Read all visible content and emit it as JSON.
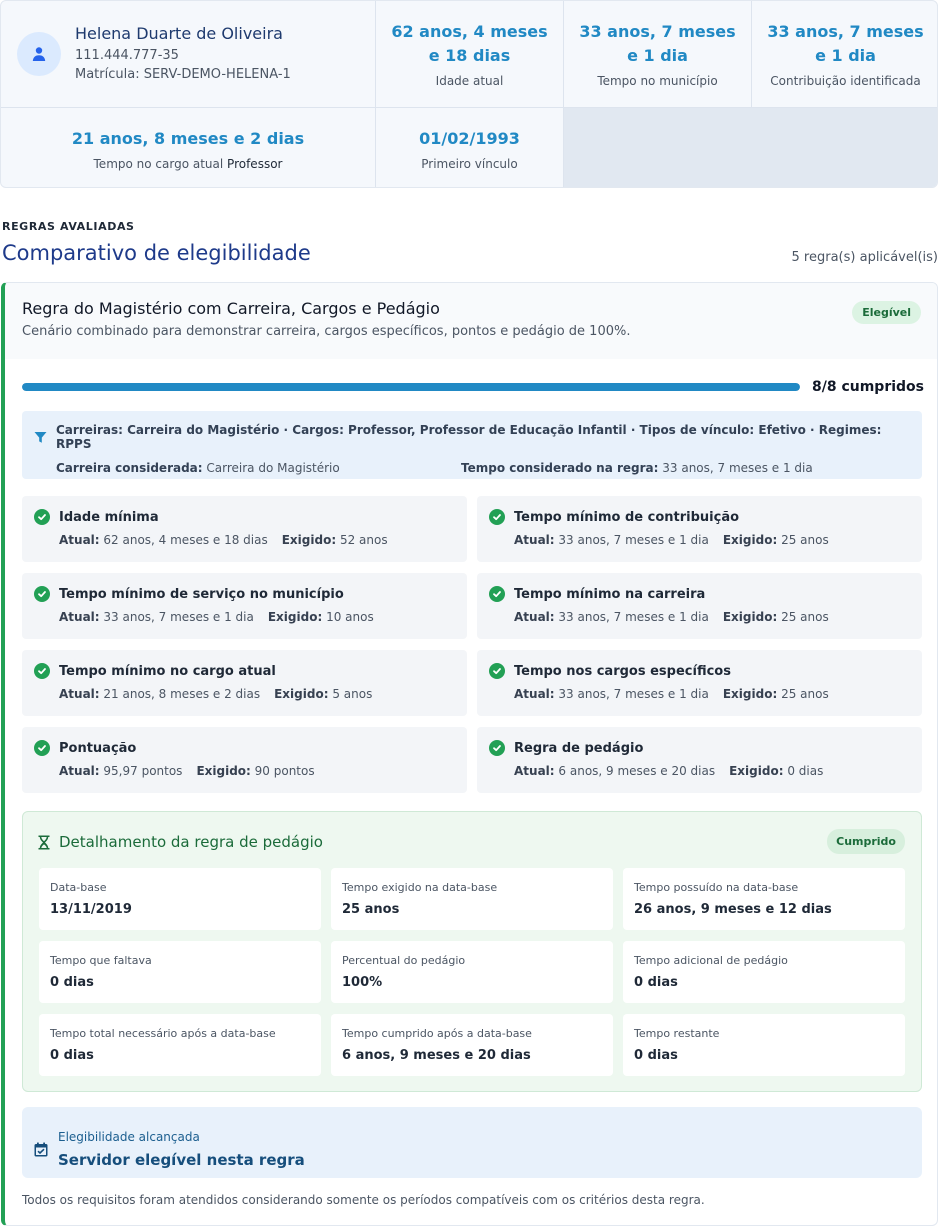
{
  "person": {
    "name": "Helena Duarte de Oliveira",
    "document": "111.444.777-35",
    "registration": "Matrícula: SERV-DEMO-HELENA-1"
  },
  "stats": {
    "age_value": "62 anos, 4 meses e 18 dias",
    "age_label": "Idade atual",
    "municipality_value": "33 anos, 7 meses e 1 dia",
    "municipality_label": "Tempo no município",
    "contribution_value": "33 anos, 7 meses e 1 dia",
    "contribution_label": "Contribuição identificada",
    "position_value": "21 anos, 8 meses e 2 dias",
    "position_label": "Tempo no cargo atual",
    "position_name": "Professor",
    "first_bond_value": "01/02/1993",
    "first_bond_label": "Primeiro vínculo"
  },
  "section": {
    "eyebrow": "REGRAS AVALIADAS",
    "title": "Comparativo de elegibilidade",
    "rule_count": "5 regra(s) aplicável(is)"
  },
  "rule": {
    "title": "Regra do Magistério com Carreira, Cargos e Pedágio",
    "description": "Cenário combinado para demonstrar carreira, cargos específicos, pontos e pedágio de 100%.",
    "status": "Elegível",
    "progress_text": "8/8 cumpridos",
    "progress_fraction": 1.0,
    "criteria_line": "Carreiras: Carreira do Magistério · Cargos: Professor, Professor de Educação Infantil · Tipos de vínculo: Efetivo · Regimes: RPPS",
    "career_label": "Carreira considerada:",
    "career_value": "Carreira do Magistério",
    "time_label": "Tempo considerado na regra:",
    "time_value": "33 anos, 7 meses e 1 dia",
    "actual_label": "Atual:",
    "required_label": "Exigido:",
    "requirements": [
      {
        "title": "Idade mínima",
        "actual": "62 anos, 4 meses e 18 dias",
        "required": "52 anos"
      },
      {
        "title": "Tempo mínimo de contribuição",
        "actual": "33 anos, 7 meses e 1 dia",
        "required": "25 anos"
      },
      {
        "title": "Tempo mínimo de serviço no município",
        "actual": "33 anos, 7 meses e 1 dia",
        "required": "10 anos"
      },
      {
        "title": "Tempo mínimo na carreira",
        "actual": "33 anos, 7 meses e 1 dia",
        "required": "25 anos"
      },
      {
        "title": "Tempo mínimo no cargo atual",
        "actual": "21 anos, 8 meses e 2 dias",
        "required": "5 anos"
      },
      {
        "title": "Tempo nos cargos específicos",
        "actual": "33 anos, 7 meses e 1 dia",
        "required": "25 anos"
      },
      {
        "title": "Pontuação",
        "actual": "95,97 pontos",
        "required": "90 pontos"
      },
      {
        "title": "Regra de pedágio",
        "actual": "6 anos, 9 meses e 20 dias",
        "required": "0 dias"
      }
    ],
    "toll": {
      "title": "Detalhamento da regra de pedágio",
      "status": "Cumprido",
      "items": [
        {
          "label": "Data-base",
          "value": "13/11/2019"
        },
        {
          "label": "Tempo exigido na data-base",
          "value": "25 anos"
        },
        {
          "label": "Tempo possuído na data-base",
          "value": "26 anos, 9 meses e 12 dias"
        },
        {
          "label": "Tempo que faltava",
          "value": "0 dias"
        },
        {
          "label": "Percentual do pedágio",
          "value": "100%"
        },
        {
          "label": "Tempo adicional de pedágio",
          "value": "0 dias"
        },
        {
          "label": "Tempo total necessário após a data-base",
          "value": "0 dias"
        },
        {
          "label": "Tempo cumprido após a data-base",
          "value": "6 anos, 9 meses e 20 dias"
        },
        {
          "label": "Tempo restante",
          "value": "0 dias"
        }
      ]
    },
    "reached_label": "Elegibilidade alcançada",
    "reached_value": "Servidor elegível nesta regra",
    "footnote": "Todos os requisitos foram atendidos considerando somente os períodos compatíveis com os critérios desta regra."
  },
  "colors": {
    "accent_blue": "#2189c4",
    "success_green": "#22a055",
    "title_navy": "#1e3a8a"
  },
  "icons": {
    "avatar": "user-icon",
    "criteria": "filter-icon",
    "requirement": "check-circle-icon",
    "toll": "hourglass-icon",
    "reached": "calendar-check-icon"
  }
}
